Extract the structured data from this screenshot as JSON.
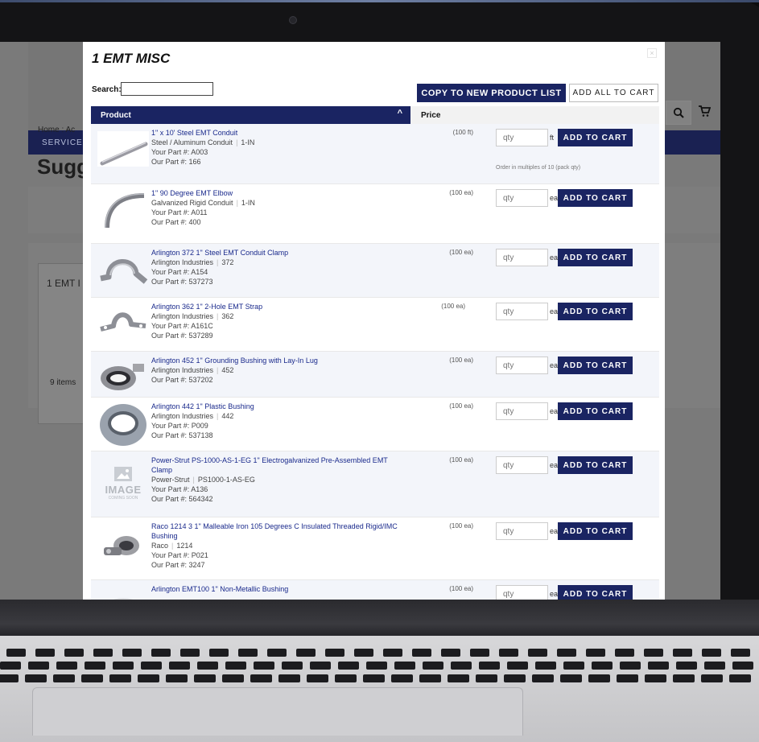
{
  "background_page": {
    "nav_label": "SERVICES",
    "breadcrumb": "Home : Ac",
    "title": "Sugg",
    "card_title": "1 EMT I",
    "card_count": "9 items"
  },
  "modal": {
    "title": "1 EMT MISC",
    "close_glyph": "×",
    "search_label": "Search:",
    "search_value": "",
    "copy_button": "COPY TO NEW PRODUCT LIST",
    "add_all_button": "ADD ALL TO CART",
    "columns": {
      "product": "Product",
      "sort_glyph": "^",
      "price": "Price"
    },
    "qty_placeholder": "qty",
    "add_label": "ADD TO CART"
  },
  "products": [
    {
      "name": "1\" x 10' Steel EMT Conduit",
      "brand": "Steel / Aluminum Conduit",
      "part": "1-IN",
      "your_part": "Your Part #: A003",
      "our_part": "Our Part #: 166",
      "unit": "(100 ft)",
      "uom": "ft",
      "note": "Order in multiples of 10 (pack qty)",
      "icon": "conduit-pipe-icon"
    },
    {
      "name": "1\" 90 Degree EMT Elbow",
      "brand": "Galvanized Rigid Conduit",
      "part": "1-IN",
      "your_part": "Your Part #: A011",
      "our_part": "Our Part #: 400",
      "unit": "(100 ea)",
      "uom": "ea",
      "note": "",
      "icon": "elbow-icon"
    },
    {
      "name": "Arlington 372 1\" Steel EMT Conduit Clamp",
      "brand": "Arlington Industries",
      "part": "372",
      "your_part": "Your Part #: A154",
      "our_part": "Our Part #: 537273",
      "unit": "(100 ea)",
      "uom": "ea",
      "note": "",
      "icon": "clamp-icon"
    },
    {
      "name": "Arlington 362 1\" 2-Hole EMT Strap",
      "brand": "Arlington Industries",
      "part": "362",
      "your_part": "Your Part #: A161C",
      "our_part": "Our Part #: 537289",
      "unit": "(100 ea)",
      "uom": "ea",
      "note": "",
      "icon": "strap-icon"
    },
    {
      "name": "Arlington 452 1\" Grounding Bushing with Lay-In Lug",
      "brand": "Arlington Industries",
      "part": "452",
      "your_part": "",
      "our_part": "Our Part #: 537202",
      "unit": "(100 ea)",
      "uom": "ea",
      "note": "",
      "icon": "grounding-bushing-icon"
    },
    {
      "name": "Arlington 442 1\" Plastic Bushing",
      "brand": "Arlington Industries",
      "part": "442",
      "your_part": "Your Part #: P009",
      "our_part": "Our Part #: 537138",
      "unit": "(100 ea)",
      "uom": "ea",
      "note": "",
      "icon": "plastic-bushing-icon"
    },
    {
      "name": "Power-Strut PS-1000-AS-1-EG 1\" Electrogalvanized Pre-Assembled EMT Clamp",
      "brand": "Power-Strut",
      "part": "PS1000-1-AS-EG",
      "your_part": "Your Part #: A136",
      "our_part": "Our Part #: 564342",
      "unit": "(100 ea)",
      "uom": "ea",
      "note": "",
      "icon": "image-placeholder-icon",
      "placeholder_main": "IMAGE",
      "placeholder_sub": "COMING SOON"
    },
    {
      "name": "Raco 1214 3 1\" Malleable Iron 105 Degrees C Insulated Threaded Rigid/IMC Bushing",
      "brand": "Raco",
      "part": "1214",
      "your_part": "Your Part #: P021",
      "our_part": "Our Part #: 3247",
      "unit": "(100 ea)",
      "uom": "ea",
      "note": "",
      "icon": "iron-bushing-icon"
    },
    {
      "name": "Arlington EMT100 1\" Non-Metallic Bushing",
      "brand": "",
      "part": "",
      "your_part": "",
      "our_part": "",
      "unit": "(100 ea)",
      "uom": "ea",
      "note": "",
      "icon": "non-metallic-bushing-icon"
    }
  ]
}
